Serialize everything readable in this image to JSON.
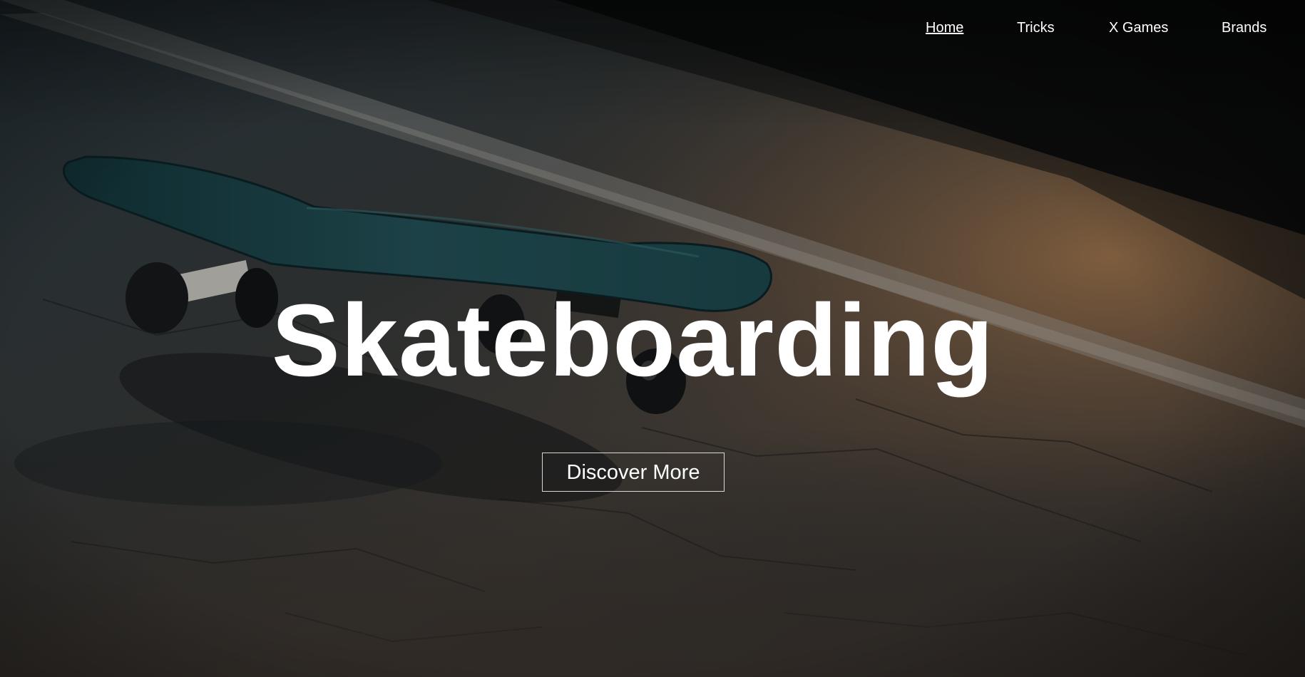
{
  "nav": {
    "items": [
      {
        "label": "Home",
        "active": true
      },
      {
        "label": "Tricks",
        "active": false
      },
      {
        "label": "X Games",
        "active": false
      },
      {
        "label": "Brands",
        "active": false
      }
    ]
  },
  "hero": {
    "title": "Skateboarding",
    "cta_label": "Discover More",
    "background_image": "skateboard-on-asphalt-photo"
  },
  "colors": {
    "text": "#ffffff",
    "button_border": "#d8d8d8",
    "road_dark": "#1f2326",
    "road_warm": "#6e543a",
    "deck_teal": "#16363a"
  }
}
